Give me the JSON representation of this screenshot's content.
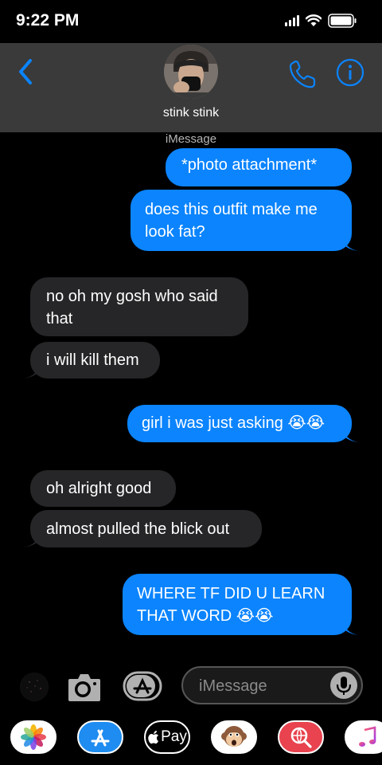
{
  "status_bar": {
    "time": "9:22 PM",
    "signal_icon": "signal-bars-icon",
    "wifi_icon": "wifi-icon",
    "battery_icon": "battery-icon"
  },
  "header": {
    "back_icon": "chevron-left-icon",
    "contact_name": "stink stink",
    "call_icon": "phone-icon",
    "info_icon": "info-icon",
    "accent_color": "#0b84fe"
  },
  "conversation": {
    "service_label": "iMessage",
    "messages": [
      {
        "direction": "sent",
        "lines": [
          "*photo attachment*"
        ]
      },
      {
        "direction": "sent",
        "lines": [
          "does this outfit make me",
          "look fat?"
        ]
      },
      {
        "direction": "received",
        "lines": [
          "no oh my gosh who said",
          "that"
        ]
      },
      {
        "direction": "received",
        "lines": [
          "i will kill them"
        ]
      },
      {
        "direction": "sent",
        "lines": [
          "girl i was just asking 😭😭"
        ]
      },
      {
        "direction": "received",
        "lines": [
          "oh alright good"
        ]
      },
      {
        "direction": "received",
        "lines": [
          "almost pulled the blick out"
        ]
      },
      {
        "direction": "sent",
        "lines": [
          "WHERE TF DID U LEARN",
          "THAT WORD 😭😭"
        ]
      }
    ],
    "sent_color": "#0b84fe",
    "received_color": "#262628"
  },
  "input_bar": {
    "placeholder": "iMessage",
    "camera_icon": "camera-icon",
    "apps_icon": "app-store-icon",
    "mic_icon": "microphone-icon"
  },
  "app_drawer": {
    "apps": [
      {
        "name": "photos-icon"
      },
      {
        "name": "app-store-icon"
      },
      {
        "name": "apple-pay-icon",
        "label": "Pay"
      },
      {
        "name": "animoji-monkey-icon"
      },
      {
        "name": "web-search-icon"
      },
      {
        "name": "music-icon"
      }
    ]
  }
}
